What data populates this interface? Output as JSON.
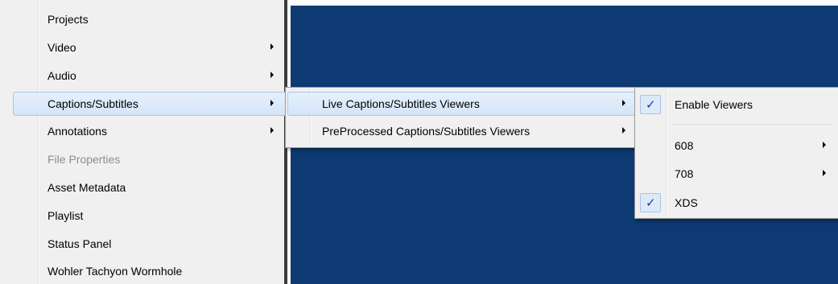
{
  "main_menu": {
    "items": [
      {
        "label": "Projects"
      },
      {
        "label": "Video"
      },
      {
        "label": "Audio"
      },
      {
        "label": "Captions/Subtitles"
      },
      {
        "label": "Annotations"
      },
      {
        "label": "File Properties",
        "disabled": true
      },
      {
        "label": "Asset Metadata"
      },
      {
        "label": "Playlist"
      },
      {
        "label": "Status Panel"
      },
      {
        "label": "Wohler Tachyon Wormhole"
      }
    ]
  },
  "captions_submenu": {
    "items": [
      {
        "label": "Live Captions/Subtitles Viewers"
      },
      {
        "label": "PreProcessed Captions/Subtitles Viewers"
      }
    ]
  },
  "viewers_submenu": {
    "items": [
      {
        "label": "Enable Viewers",
        "checked": true
      },
      {
        "label": "608"
      },
      {
        "label": "708"
      },
      {
        "label": "XDS",
        "checked": true
      }
    ]
  },
  "colors": {
    "background": "#0d3a72",
    "menu": "#f0f0f0",
    "highlight": "#d4e5f8",
    "check": "#1b3f9a"
  },
  "icons": [
    "submenu-arrow-icon",
    "checkmark-icon"
  ]
}
